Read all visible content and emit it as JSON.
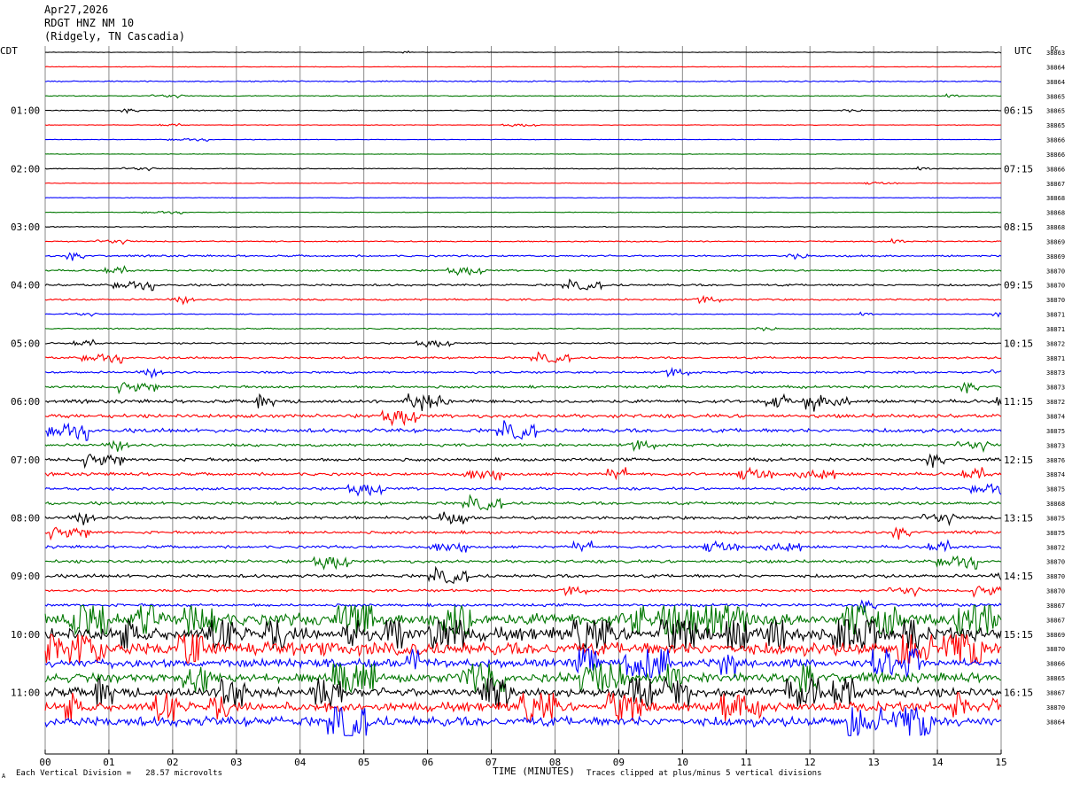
{
  "header": {
    "date": "Apr27,2026",
    "station": "RDGT HNZ NM 10",
    "location": "(Ridgely, TN Cascadia)"
  },
  "labels": {
    "left_tz": "CDT",
    "right_tz": "UTC",
    "dc": "DC"
  },
  "footer": {
    "scale": "Each Vertical Division =   28.57 microvolts",
    "clip": "Traces clipped at plus/minus 5 vertical divisions",
    "corner": "A"
  },
  "chart_data": {
    "type": "line",
    "xlabel": "TIME (MINUTES)",
    "xticks": [
      "00",
      "01",
      "02",
      "03",
      "04",
      "05",
      "06",
      "07",
      "08",
      "09",
      "10",
      "11",
      "12",
      "13",
      "14",
      "15"
    ],
    "xlim": [
      0,
      15
    ],
    "colors": [
      "#000000",
      "#ff0000",
      "#0000ff",
      "#007700"
    ],
    "left_hour_labels": [
      "01:00",
      "02:00",
      "03:00",
      "04:00",
      "05:00",
      "06:00",
      "07:00",
      "08:00",
      "09:00",
      "10:00",
      "11:00"
    ],
    "right_hour_labels": [
      "06:15",
      "07:15",
      "08:15",
      "09:15",
      "10:15",
      "11:15",
      "12:15",
      "13:15",
      "14:15",
      "15:15",
      "16:15"
    ],
    "dc_offsets": [
      "38863",
      "38864",
      "38864",
      "38865",
      "38865",
      "38865",
      "38866",
      "38866",
      "38866",
      "38867",
      "38868",
      "38868",
      "38868",
      "38869",
      "38869",
      "38870",
      "38870",
      "38870",
      "38871",
      "38871",
      "38872",
      "38871",
      "38873",
      "38873",
      "38872",
      "38874",
      "38875",
      "38873",
      "38876",
      "38874",
      "38875",
      "38868",
      "38875",
      "38875",
      "38872",
      "38870",
      "38870",
      "38870",
      "38867",
      "38867",
      "38869",
      "38870",
      "38866",
      "38865",
      "38867",
      "38870",
      "38864"
    ],
    "row_activity": [
      0.2,
      0.2,
      0.4,
      0.3,
      0.3,
      0.2,
      0.2,
      0.2,
      0.3,
      0.2,
      0.2,
      0.2,
      0.3,
      0.4,
      0.6,
      0.6,
      0.7,
      0.6,
      0.3,
      0.4,
      0.5,
      0.7,
      0.7,
      0.8,
      1.1,
      1.2,
      1.3,
      0.9,
      1.0,
      1.0,
      0.9,
      1.0,
      1.0,
      0.9,
      0.9,
      1.0,
      1.1,
      0.8,
      0.9,
      4.0,
      4.3,
      4.3,
      2.8,
      3.0,
      3.0,
      3.0,
      3.2
    ]
  }
}
